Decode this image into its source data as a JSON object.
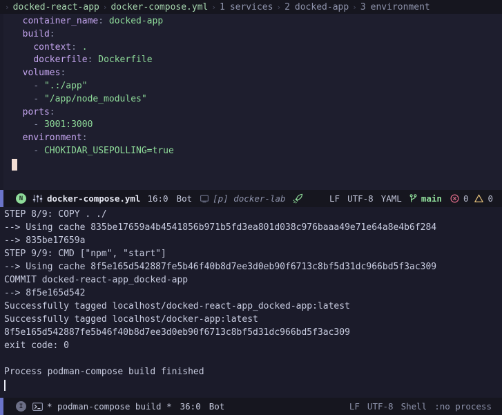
{
  "breadcrumb": {
    "separator": "›",
    "crumbs": [
      {
        "index": "",
        "label": "docked-react-app",
        "dim": false
      },
      {
        "index": "",
        "label": "docker-compose.yml",
        "dim": false
      },
      {
        "index": "1",
        "label": "services",
        "dim": true
      },
      {
        "index": "2",
        "label": "docked-app",
        "dim": true
      },
      {
        "index": "3",
        "label": "environment",
        "dim": true
      }
    ]
  },
  "editor": {
    "lines": [
      [
        {
          "t": "plain",
          "v": "  "
        },
        {
          "t": "key",
          "v": "container_name"
        },
        {
          "t": "punct",
          "v": ": "
        },
        {
          "t": "str",
          "v": "docked-app"
        }
      ],
      [
        {
          "t": "plain",
          "v": "  "
        },
        {
          "t": "key",
          "v": "build"
        },
        {
          "t": "punct",
          "v": ":"
        }
      ],
      [
        {
          "t": "plain",
          "v": "    "
        },
        {
          "t": "key",
          "v": "context"
        },
        {
          "t": "punct",
          "v": ": "
        },
        {
          "t": "str",
          "v": "."
        }
      ],
      [
        {
          "t": "plain",
          "v": "    "
        },
        {
          "t": "key",
          "v": "dockerfile"
        },
        {
          "t": "punct",
          "v": ": "
        },
        {
          "t": "str",
          "v": "Dockerfile"
        }
      ],
      [
        {
          "t": "plain",
          "v": "  "
        },
        {
          "t": "key",
          "v": "volumes"
        },
        {
          "t": "punct",
          "v": ":"
        }
      ],
      [
        {
          "t": "plain",
          "v": "    "
        },
        {
          "t": "dash",
          "v": "- "
        },
        {
          "t": "str",
          "v": "\".:/app\""
        }
      ],
      [
        {
          "t": "plain",
          "v": "    "
        },
        {
          "t": "dash",
          "v": "- "
        },
        {
          "t": "str",
          "v": "\"/app/node_modules\""
        }
      ],
      [
        {
          "t": "plain",
          "v": "  "
        },
        {
          "t": "key",
          "v": "ports"
        },
        {
          "t": "punct",
          "v": ":"
        }
      ],
      [
        {
          "t": "plain",
          "v": "    "
        },
        {
          "t": "dash",
          "v": "- "
        },
        {
          "t": "num",
          "v": "3001:3000"
        }
      ],
      [
        {
          "t": "plain",
          "v": "  "
        },
        {
          "t": "key",
          "v": "environment"
        },
        {
          "t": "punct",
          "v": ":"
        }
      ],
      [
        {
          "t": "plain",
          "v": "    "
        },
        {
          "t": "dash",
          "v": "- "
        },
        {
          "t": "str",
          "v": "CHOKIDAR_USEPOLLING=true"
        }
      ],
      [],
      []
    ]
  },
  "editor_status": {
    "mode": "N",
    "mode_name": "NORMAL",
    "filename": "docker-compose.yml",
    "position": "16:0",
    "position_suffix": "Bot",
    "project": "[p] docker-lab",
    "line_ending": "LF",
    "encoding": "UTF-8",
    "language": "YAML",
    "branch": "main",
    "error_count": "0",
    "warning_count": "0"
  },
  "terminal": {
    "lines": [
      "STEP 8/9: COPY . ./",
      "--> Using cache 835be17659a4b4541856b971b5fd3ea801d038c976baaa49e71e64a8e4b6f284",
      "--> 835be17659a",
      "STEP 9/9: CMD [\"npm\", \"start\"]",
      "--> Using cache 8f5e165d542887fe5b46f40b8d7ee3d0eb90f6713c8bf5d31dc966bd5f3ac309",
      "COMMIT docked-react-app_docked-app",
      "--> 8f5e165d542",
      "Successfully tagged localhost/docked-react-app_docked-app:latest",
      "Successfully tagged localhost/docker-app:latest",
      "8f5e165d542887fe5b46f40b8d7ee3d0eb90f6713c8bf5d31dc966bd5f3ac309",
      "exit code: 0",
      "",
      "Process podman-compose build finished",
      ""
    ]
  },
  "terminal_status": {
    "mode": "I",
    "mode_name": "INSERT",
    "command": "* podman-compose build *",
    "position": "36:0",
    "position_suffix": "Bot",
    "line_ending": "LF",
    "encoding": "UTF-8",
    "shell_label": "Shell",
    "shell_state": ":no process"
  },
  "colors": {
    "editor_bg": "#1e1e2e",
    "terminal_bg": "#1b1b2a",
    "statusbar_bg": "#16161f",
    "accent": "#6b74c9",
    "yaml_key": "#c5a6f0",
    "yaml_value": "#8fdc9a",
    "error": "#e06c8a",
    "warning": "#e5c07b"
  }
}
